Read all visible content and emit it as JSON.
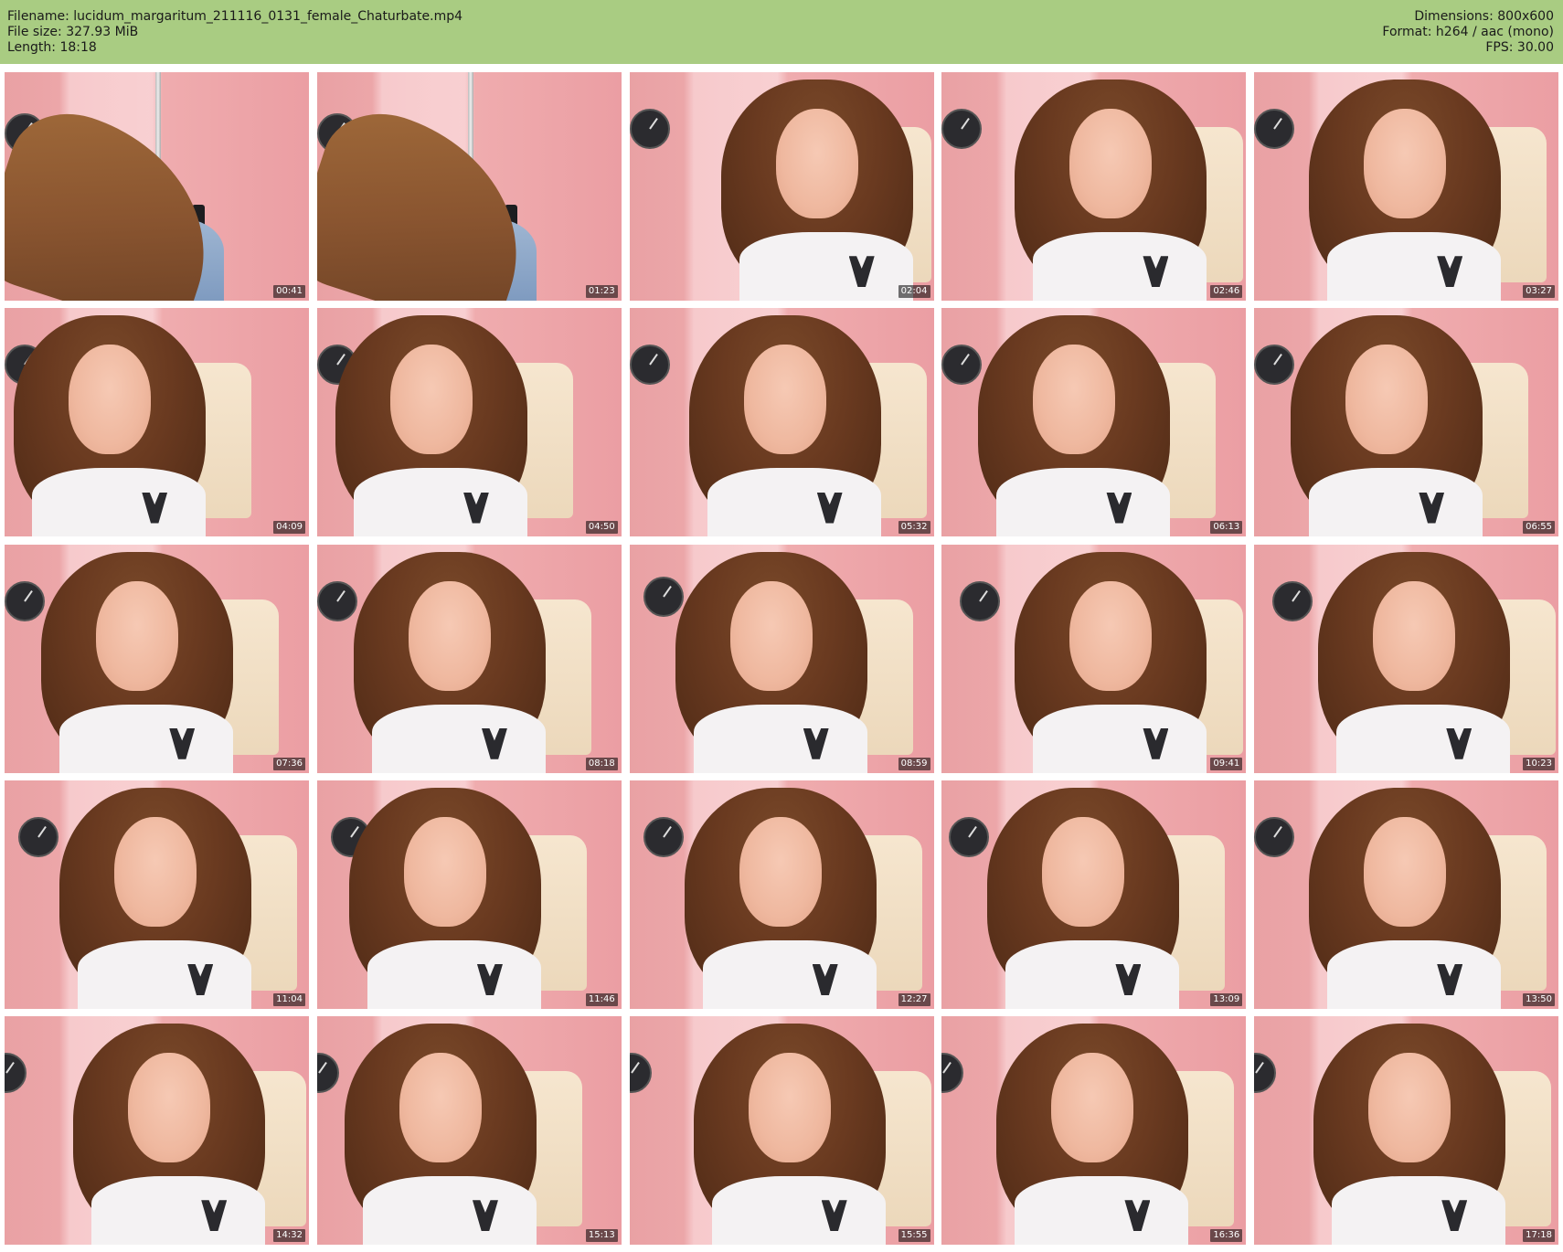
{
  "header": {
    "filename": "Filename: lucidum_margaritum_211116_0131_female_Chaturbate.mp4",
    "file_size": "File size: 327.93 MiB",
    "length": "Length: 18:18",
    "dimensions": "Dimensions: 800x600",
    "format": "Format: h264 / aac (mono)",
    "fps": "FPS: 30.00",
    "background_color": "#a9cc82"
  },
  "thumbnails": [
    {
      "time": "00:41",
      "scene": "lying"
    },
    {
      "time": "01:23",
      "scene": "lying"
    },
    {
      "time": "02:04",
      "scene": "portrait"
    },
    {
      "time": "02:46",
      "scene": "portrait"
    },
    {
      "time": "03:27",
      "scene": "portrait"
    },
    {
      "time": "04:09",
      "scene": "portrait"
    },
    {
      "time": "04:50",
      "scene": "portrait"
    },
    {
      "time": "05:32",
      "scene": "portrait"
    },
    {
      "time": "06:13",
      "scene": "portrait"
    },
    {
      "time": "06:55",
      "scene": "portrait"
    },
    {
      "time": "07:36",
      "scene": "portrait"
    },
    {
      "time": "08:18",
      "scene": "portrait"
    },
    {
      "time": "08:59",
      "scene": "portrait"
    },
    {
      "time": "09:41",
      "scene": "portrait"
    },
    {
      "time": "10:23",
      "scene": "portrait"
    },
    {
      "time": "11:04",
      "scene": "portrait"
    },
    {
      "time": "11:46",
      "scene": "portrait"
    },
    {
      "time": "12:27",
      "scene": "portrait"
    },
    {
      "time": "13:09",
      "scene": "portrait"
    },
    {
      "time": "13:50",
      "scene": "portrait"
    },
    {
      "time": "14:32",
      "scene": "portrait"
    },
    {
      "time": "15:13",
      "scene": "portrait"
    },
    {
      "time": "15:55",
      "scene": "portrait"
    },
    {
      "time": "16:36",
      "scene": "portrait"
    },
    {
      "time": "17:18",
      "scene": "portrait"
    }
  ]
}
